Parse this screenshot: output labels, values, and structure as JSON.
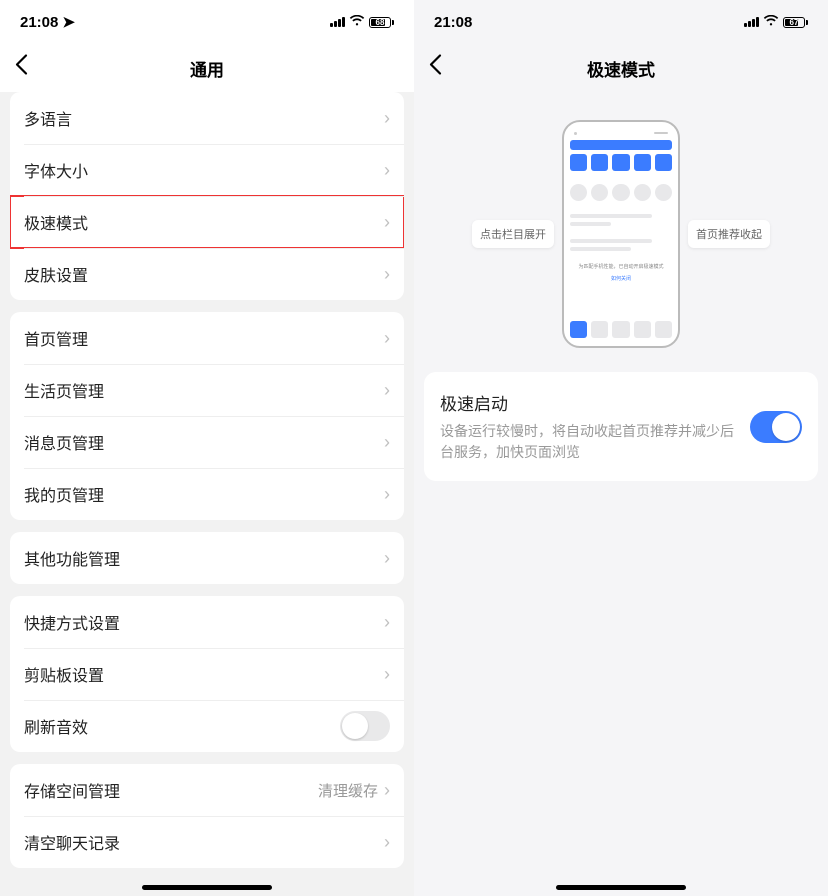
{
  "left": {
    "status": {
      "time": "21:08",
      "battery": "68"
    },
    "title": "通用",
    "groups": [
      {
        "rows": [
          {
            "label": "多语言",
            "highlight": false
          },
          {
            "label": "字体大小",
            "highlight": false
          },
          {
            "label": "极速模式",
            "highlight": true
          },
          {
            "label": "皮肤设置",
            "highlight": false
          }
        ]
      },
      {
        "rows": [
          {
            "label": "首页管理",
            "highlight": false
          },
          {
            "label": "生活页管理",
            "highlight": false
          },
          {
            "label": "消息页管理",
            "highlight": false
          },
          {
            "label": "我的页管理",
            "highlight": false
          }
        ]
      },
      {
        "rows": [
          {
            "label": "其他功能管理",
            "highlight": false
          }
        ]
      },
      {
        "rows": [
          {
            "label": "快捷方式设置",
            "highlight": false
          },
          {
            "label": "剪贴板设置",
            "highlight": false
          },
          {
            "label": "刷新音效",
            "highlight": false,
            "switch": true,
            "on": false
          }
        ]
      },
      {
        "rows": [
          {
            "label": "存储空间管理",
            "highlight": false,
            "value": "清理缓存"
          },
          {
            "label": "清空聊天记录",
            "highlight": false
          }
        ]
      }
    ]
  },
  "right": {
    "status": {
      "time": "21:08",
      "battery": "67"
    },
    "title": "极速模式",
    "badge_left": "点击栏目展开",
    "badge_right": "首页推荐收起",
    "mini_sub": "为匹配手机性能，已自动开启极速模式",
    "mini_link": "如何关闭",
    "card": {
      "title": "极速启动",
      "desc": "设备运行较慢时，将自动收起首页推荐并减少后台服务，加快页面浏览",
      "on": true
    }
  }
}
